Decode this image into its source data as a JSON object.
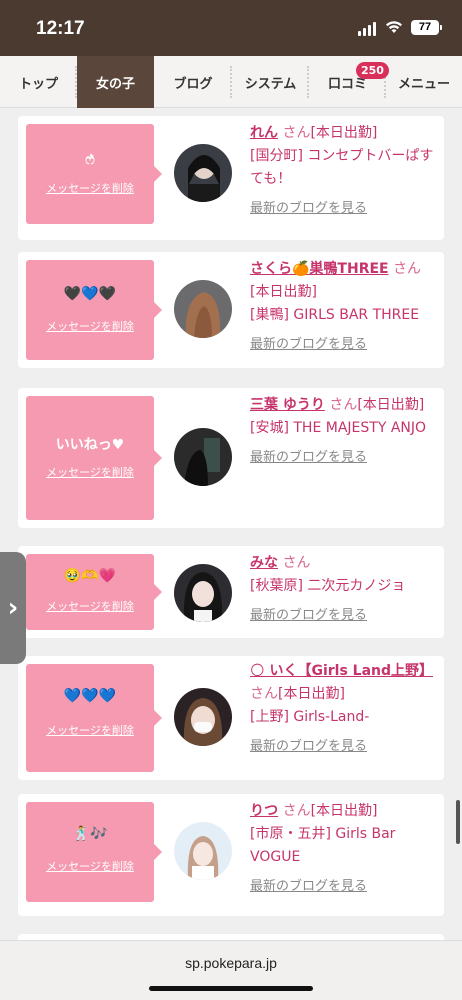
{
  "status_bar": {
    "time": "12:17",
    "battery": "77"
  },
  "nav": {
    "tabs": [
      {
        "label": "トップ"
      },
      {
        "label": "女の子"
      },
      {
        "label": "ブログ"
      },
      {
        "label": "システム"
      },
      {
        "label": "口コミ"
      },
      {
        "label": "メニュー"
      }
    ],
    "badge": "250"
  },
  "common": {
    "delete_label": "メッセージを削除",
    "latest_blog_label": "最新のブログを見る"
  },
  "cards": [
    {
      "message": "ෆ͛",
      "name": "れん",
      "san": "さん",
      "status": "[本日出勤]",
      "area_shop": "[国分町] コンセプトバーぱすても！"
    },
    {
      "message": "🖤💙🖤",
      "name": "さくら🍊巣鴨THREE",
      "san": "さん",
      "status": "[本日出勤]",
      "area_shop": "[巣鴨] GIRLS BAR THREE"
    },
    {
      "message": "いいねっ♥",
      "name": "三葉 ゆうり",
      "san": "さん",
      "status": "[本日出勤]",
      "area_shop": "[安城] THE MAJESTY ANJO"
    },
    {
      "message": "🥹🫶💗",
      "name": "みな",
      "san": "さん",
      "status": "",
      "area_shop": "[秋葉原] 二次元カノジョ"
    },
    {
      "message": "💙💙💙",
      "name": "🌕 いく【Girls Land上野】",
      "san": "さん",
      "status": "[本日出勤]",
      "area_shop": "[上野] Girls-Land-"
    },
    {
      "message": "🕺🎶",
      "name": "りつ",
      "san": "さん",
      "status": "[本日出勤]",
      "area_shop": "[市原・五井] Girls Bar VOGUE"
    }
  ],
  "url": "sp.pokepara.jp",
  "icons": {
    "scroll_handle": "chevron-right-icon",
    "wifi": "wifi-icon",
    "signal": "signal-icon"
  },
  "colors": {
    "pink": "#f59ab0",
    "accent": "#c7346b",
    "nav_active": "#5a463a",
    "status_bar": "#4a3a30"
  }
}
